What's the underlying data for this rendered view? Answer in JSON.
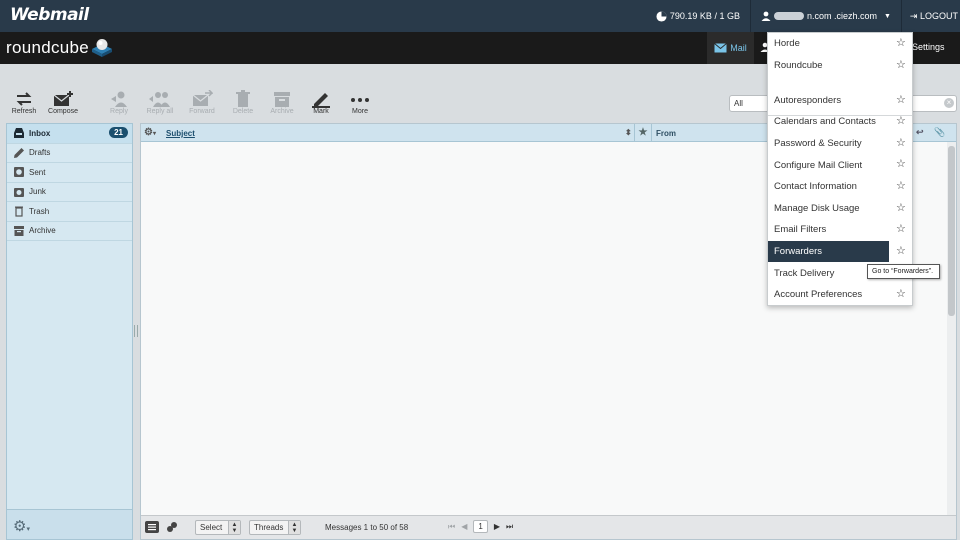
{
  "cpanel": {
    "brand": "Webmail",
    "disk_usage": "790.19 KB / 1 GB",
    "user_email_suffix": "n.com .ciezh.com",
    "logout": "LOGOUT"
  },
  "roundcube": {
    "logo": "roundcube",
    "nav": {
      "mail": "Mail",
      "settings": "Settings"
    }
  },
  "toolbar": {
    "refresh": "Refresh",
    "compose": "Compose",
    "reply": "Reply",
    "reply_all": "Reply all",
    "forward": "Forward",
    "delete": "Delete",
    "archive": "Archive",
    "mark": "Mark",
    "more": "More"
  },
  "search": {
    "scope": "All"
  },
  "folders": [
    {
      "label": "Inbox",
      "count": "21",
      "icon": "inbox-icon"
    },
    {
      "label": "Drafts",
      "icon": "pencil-icon"
    },
    {
      "label": "Sent",
      "icon": "sent-icon"
    },
    {
      "label": "Junk",
      "icon": "junk-icon"
    },
    {
      "label": "Trash",
      "icon": "trash-icon"
    },
    {
      "label": "Archive",
      "icon": "archive-icon"
    }
  ],
  "list": {
    "columns": {
      "subject": "Subject",
      "from": "From"
    },
    "footer": {
      "select": "Select",
      "threads": "Threads",
      "count": "Messages 1 to 50 of 58",
      "page": "1"
    }
  },
  "menu": {
    "items": [
      {
        "label": "Horde"
      },
      {
        "label": "Roundcube"
      },
      {
        "label": "Autoresponders"
      },
      {
        "label": "Calendars and Contacts"
      },
      {
        "label": "Password & Security"
      },
      {
        "label": "Configure Mail Client"
      },
      {
        "label": "Contact Information"
      },
      {
        "label": "Manage Disk Usage"
      },
      {
        "label": "Email Filters"
      },
      {
        "label": "Forwarders"
      },
      {
        "label": "Track Delivery"
      },
      {
        "label": "Account Preferences"
      }
    ],
    "tooltip": "Go to “Forwarders”."
  },
  "colors": {
    "cpanel_bar": "#293a4a",
    "roundcube_bar": "#1a1a1a",
    "accent": "#7ac4e8",
    "folder_panel": "#d6e8f1",
    "badge": "#1a4f6e"
  }
}
